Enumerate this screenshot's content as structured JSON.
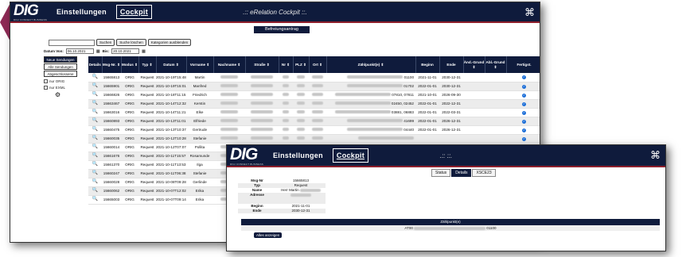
{
  "brand": {
    "logo": "DIG",
    "tagline": "DIGI CONNECT BUSINESS"
  },
  "nav": {
    "settings": "Einstellungen",
    "cockpit": "Cockpit"
  },
  "main": {
    "title": ".:: eRelation Cockpit ::.",
    "section_header": "Befreiungsantrag",
    "search_value": "",
    "buttons": {
      "search": "Suchen",
      "search_new": "Suche löschen",
      "hide_categories": "Kategorien ausblenden"
    },
    "date_from_label": "Datum Von:",
    "date_from": "06.10.2021",
    "date_to_label": "Bis:",
    "date_to": "20.10.2021",
    "left_buttons": [
      "Neue Sendungen",
      "Alle Sendungen",
      "Abgeschlossene"
    ],
    "filters": [
      "nur ORIG",
      "nur EXML"
    ],
    "columns": [
      "Details",
      "Msg-Nr. ⇕",
      "Modus ⇕",
      "Typ ⇕",
      "Datum ⇕",
      "Vorname ⇕",
      "Nachname ⇕",
      "Straße ⇕",
      "Nr ⇕",
      "PLZ ⇕",
      "Ort ⇕",
      "Zählpunkt(e) ⇕",
      "Beginn",
      "Ende",
      "Änd.-Grund ⇕",
      "Abl.-Grund ⇕",
      "Fertigst."
    ],
    "rows": [
      {
        "nr": "15665813",
        "modus": "ORIG",
        "typ": "Request",
        "datum": "2021-10-19T15:48:45",
        "vorname": "Martin",
        "zp": "01100",
        "beginn": "2021-11-01",
        "ende": "2030-12-31"
      },
      {
        "nr": "15665901",
        "modus": "ORIG",
        "typ": "Request",
        "datum": "2021-10-19T15:01:47",
        "vorname": "Manfred",
        "zp": "01702",
        "beginn": "2022-01-01",
        "ende": "2030-12-31"
      },
      {
        "nr": "15666826",
        "modus": "ORIG",
        "typ": "Request",
        "datum": "2021-10-18T11:15:57",
        "vorname": "Friedrich",
        "zp": "07810, 07811",
        "beginn": "2021-10-01",
        "ende": "2026-09-30"
      },
      {
        "nr": "15663467",
        "modus": "ORIG",
        "typ": "Request",
        "datum": "2021-10-14T12:32:58",
        "vorname": "Kerstin",
        "zp": "02450, 02452",
        "beginn": "2022-01-01",
        "ende": "2022-12-31"
      },
      {
        "nr": "15663016",
        "modus": "ORIG",
        "typ": "Request",
        "datum": "2021-10-14T11:21:59",
        "vorname": "Elke",
        "zp": "03881, 06883",
        "beginn": "2022-01-01",
        "ende": "2022-03-31"
      },
      {
        "nr": "15660893",
        "modus": "ORIG",
        "typ": "Request",
        "datum": "2021-10-13T11:01:32",
        "vorname": "Elfriede",
        "zp": "41699",
        "beginn": "2022-01-01",
        "ende": "2026-12-31"
      },
      {
        "nr": "15660475",
        "modus": "ORIG",
        "typ": "Request",
        "datum": "2021-10-13T10:37:48",
        "vorname": "Gertrude",
        "zp": "04440",
        "beginn": "2022-01-01",
        "ende": "2026-12-31"
      },
      {
        "nr": "15660035",
        "modus": "ORIG",
        "typ": "Request",
        "datum": "2021-10-12T10:28:14",
        "vorname": "Stefanie",
        "zp": "",
        "beginn": "",
        "ende": ""
      },
      {
        "nr": "15660014",
        "modus": "ORIG",
        "typ": "Request",
        "datum": "2021-10-12T07:07:19",
        "vorname": "Pollita",
        "zp": "",
        "beginn": "",
        "ende": ""
      },
      {
        "nr": "15661676",
        "modus": "ORIG",
        "typ": "Request",
        "datum": "2021-10-11T15:57:46",
        "vorname": "Rosamunde",
        "zp": "",
        "beginn": "",
        "ende": ""
      },
      {
        "nr": "15661370",
        "modus": "ORIG",
        "typ": "Request",
        "datum": "2021-10-11T13:53:55",
        "vorname": "Ilga",
        "zp": "",
        "beginn": "",
        "ende": ""
      },
      {
        "nr": "15660247",
        "modus": "ORIG",
        "typ": "Request",
        "datum": "2021-10-11T06:38:31",
        "vorname": "Stefanie",
        "zp": "",
        "beginn": "",
        "ende": ""
      },
      {
        "nr": "15660028",
        "modus": "ORIG",
        "typ": "Request",
        "datum": "2021-10-08T09:28:22",
        "vorname": "Gerlinde",
        "zp": "",
        "beginn": "",
        "ende": ""
      },
      {
        "nr": "15660062",
        "modus": "ORIG",
        "typ": "Request",
        "datum": "2021-10-07T12:02:56",
        "vorname": "Erika",
        "zp": "",
        "beginn": "",
        "ende": ""
      },
      {
        "nr": "15665003",
        "modus": "ORIG",
        "typ": "Request",
        "datum": "2021-10-07T09:14:45",
        "vorname": "Erika",
        "zp": "",
        "beginn": "",
        "ende": ""
      }
    ]
  },
  "detail": {
    "title": ".:: ::.",
    "tabs": [
      "Status",
      "Details",
      "XSCE23"
    ],
    "fields": [
      {
        "k": "Msg-Nr",
        "v": "15665813"
      },
      {
        "k": "Typ",
        "v": "Request"
      },
      {
        "k": "Name",
        "v": "Herr Martin"
      },
      {
        "k": "Adresse",
        "v": ""
      },
      {
        "k": "Beginn",
        "v": "2021-11-01"
      },
      {
        "k": "Ende",
        "v": "2030-12-31"
      }
    ],
    "zp_header": "Zählpunkt(e)",
    "zp_value_prefix": "AT00",
    "zp_value_suffix": "01100",
    "alles_button": "Alles anzeigen"
  },
  "colors": {
    "navy": "#0f1b3c",
    "accent": "#8e1f2c",
    "check": "#1d6fd8"
  }
}
